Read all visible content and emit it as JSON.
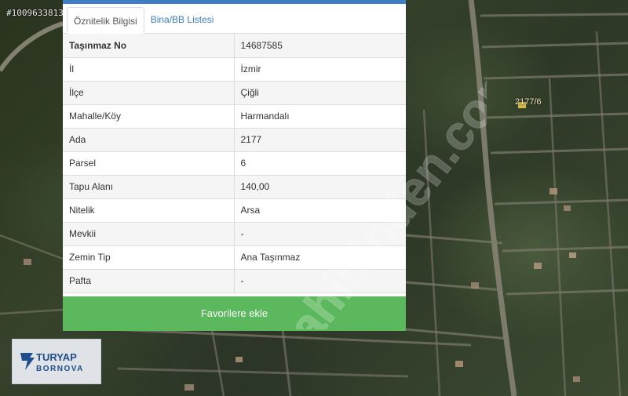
{
  "listing_id": "#1009633813",
  "map": {
    "parcel_label": "2177/6"
  },
  "tabs": [
    {
      "label": "Öznitelik Bilgisi",
      "active": true
    },
    {
      "label": "Bina/BB Listesi",
      "active": false
    }
  ],
  "attributes": [
    {
      "key": "Taşınmaz No",
      "value": "14687585"
    },
    {
      "key": "İl",
      "value": "İzmir"
    },
    {
      "key": "İlçe",
      "value": "Çiğli"
    },
    {
      "key": "Mahalle/Köy",
      "value": "Harmandalı"
    },
    {
      "key": "Ada",
      "value": "2177"
    },
    {
      "key": "Parsel",
      "value": "6"
    },
    {
      "key": "Tapu Alanı",
      "value": "140,00"
    },
    {
      "key": "Nitelik",
      "value": "Arsa"
    },
    {
      "key": "Mevkii",
      "value": "-"
    },
    {
      "key": "Zemin Tip",
      "value": "Ana Taşınmaz"
    },
    {
      "key": "Pafta",
      "value": "-"
    }
  ],
  "favorite_button": {
    "label": "Favorilere ekle",
    "color": "#5cb85c"
  },
  "accent_color": "#3d7fc4",
  "watermark": "sahibinden.com",
  "logo": {
    "brand": "TURYAP",
    "branch": "BORNOVA"
  }
}
